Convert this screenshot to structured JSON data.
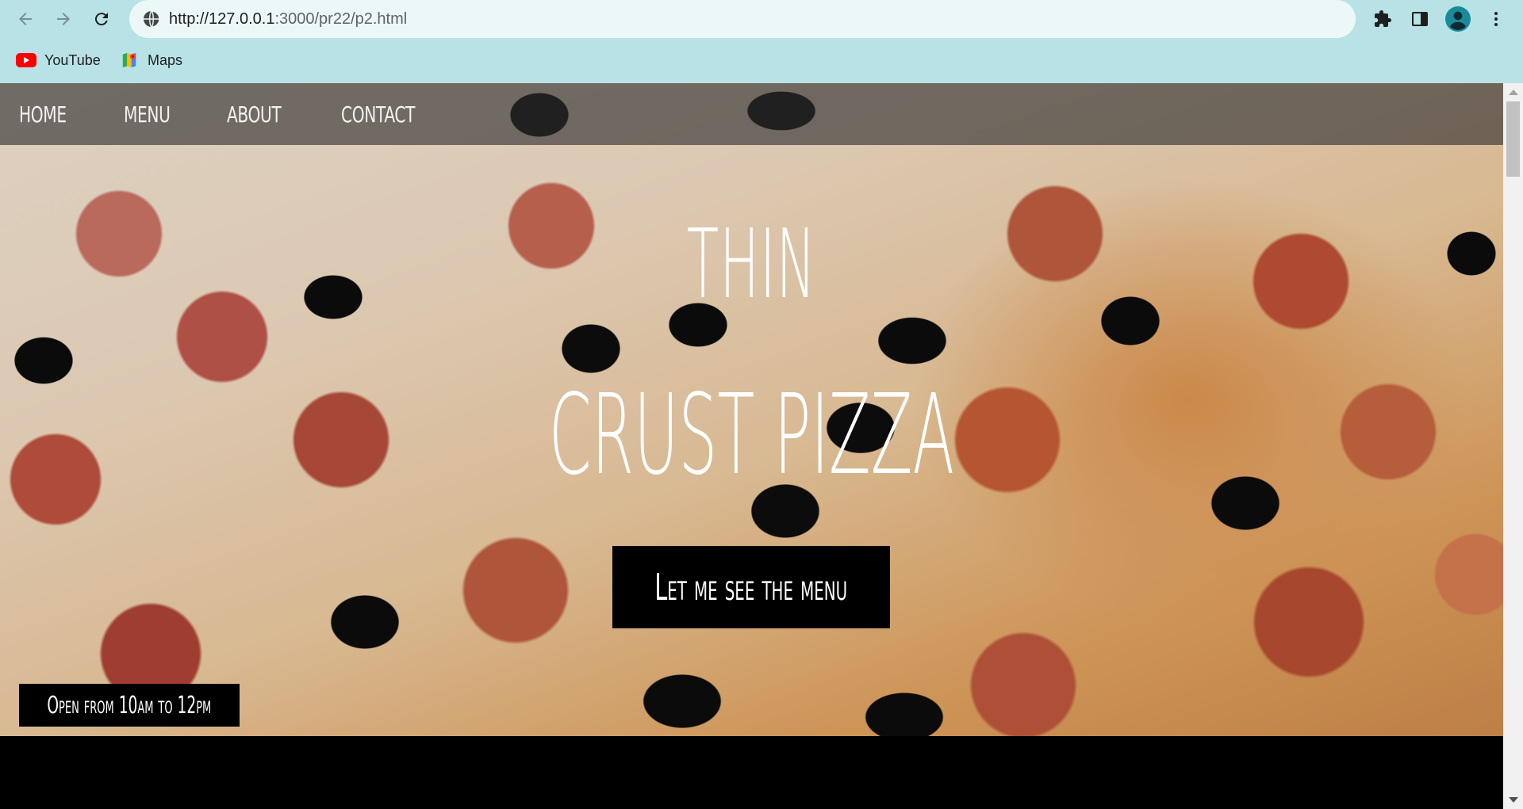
{
  "browser": {
    "url_host": "http://127.0.0.1",
    "url_rest": ":3000/pr22/p2.html",
    "bookmarks": [
      {
        "label": "YouTube",
        "icon": "youtube-icon"
      },
      {
        "label": "Maps",
        "icon": "maps-icon"
      }
    ],
    "colors": {
      "chrome_bg": "#b8e2e5",
      "omnibox_bg": "#ecf8f8",
      "profile_accent": "#1a8a9a"
    }
  },
  "site": {
    "nav": [
      "HOME",
      "MENU",
      "ABOUT",
      "CONTACT"
    ],
    "hero": {
      "title_line1": "THIN",
      "title_line2": "CRUST PIZZA",
      "cta_label": "Let me see the menu",
      "hours": "Open from 10am to 12pm"
    },
    "colors": {
      "text": "#ffffff",
      "button_bg": "#000000",
      "nav_bg": "#2d2d2d"
    }
  }
}
